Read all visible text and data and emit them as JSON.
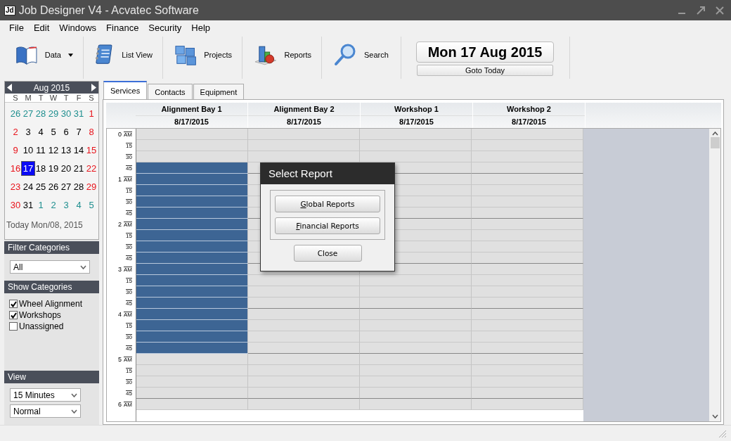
{
  "window": {
    "title": "Job Designer V4 - Acvatec Software",
    "icon_text": "Jd"
  },
  "menu": [
    "File",
    "Edit",
    "Windows",
    "Finance",
    "Security",
    "Help"
  ],
  "toolbar": [
    {
      "label": "Data",
      "dropdown": true
    },
    {
      "label": "List View",
      "dropdown": false
    },
    {
      "label": "Projects",
      "dropdown": false
    },
    {
      "label": "Reports",
      "dropdown": false
    },
    {
      "label": "Search",
      "dropdown": false
    }
  ],
  "date_display": {
    "date": "Mon 17 Aug 2015",
    "button": "Goto Today"
  },
  "calendar": {
    "month": "Aug 2015",
    "weekdays": [
      "S",
      "M",
      "T",
      "W",
      "T",
      "F",
      "S"
    ],
    "weeks": [
      [
        {
          "day": "26",
          "kind": "other",
          "selected": false
        },
        {
          "day": "27",
          "kind": "other",
          "selected": false
        },
        {
          "day": "28",
          "kind": "other",
          "selected": false
        },
        {
          "day": "29",
          "kind": "other",
          "selected": false
        },
        {
          "day": "30",
          "kind": "other",
          "selected": false
        },
        {
          "day": "31",
          "kind": "other",
          "selected": false
        },
        {
          "day": "1",
          "kind": "weekend",
          "selected": false
        }
      ],
      [
        {
          "day": "2",
          "kind": "weekend",
          "selected": false
        },
        {
          "day": "3",
          "kind": "weekday",
          "selected": false
        },
        {
          "day": "4",
          "kind": "weekday",
          "selected": false
        },
        {
          "day": "5",
          "kind": "weekday",
          "selected": false
        },
        {
          "day": "6",
          "kind": "weekday",
          "selected": false
        },
        {
          "day": "7",
          "kind": "weekday",
          "selected": false
        },
        {
          "day": "8",
          "kind": "weekend",
          "selected": false
        }
      ],
      [
        {
          "day": "9",
          "kind": "weekend",
          "selected": false
        },
        {
          "day": "10",
          "kind": "weekday",
          "selected": false
        },
        {
          "day": "11",
          "kind": "weekday",
          "selected": false
        },
        {
          "day": "12",
          "kind": "weekday",
          "selected": false
        },
        {
          "day": "13",
          "kind": "weekday",
          "selected": false
        },
        {
          "day": "14",
          "kind": "weekday",
          "selected": false
        },
        {
          "day": "15",
          "kind": "weekend",
          "selected": false
        }
      ],
      [
        {
          "day": "16",
          "kind": "weekend",
          "selected": false
        },
        {
          "day": "17",
          "kind": "weekday",
          "selected": true
        },
        {
          "day": "18",
          "kind": "weekday",
          "selected": false
        },
        {
          "day": "19",
          "kind": "weekday",
          "selected": false
        },
        {
          "day": "20",
          "kind": "weekday",
          "selected": false
        },
        {
          "day": "21",
          "kind": "weekday",
          "selected": false
        },
        {
          "day": "22",
          "kind": "weekend",
          "selected": false
        }
      ],
      [
        {
          "day": "23",
          "kind": "weekend",
          "selected": false
        },
        {
          "day": "24",
          "kind": "weekday",
          "selected": false
        },
        {
          "day": "25",
          "kind": "weekday",
          "selected": false
        },
        {
          "day": "26",
          "kind": "weekday",
          "selected": false
        },
        {
          "day": "27",
          "kind": "weekday",
          "selected": false
        },
        {
          "day": "28",
          "kind": "weekday",
          "selected": false
        },
        {
          "day": "29",
          "kind": "weekend",
          "selected": false
        }
      ],
      [
        {
          "day": "30",
          "kind": "weekend",
          "selected": false
        },
        {
          "day": "31",
          "kind": "weekday",
          "selected": false
        },
        {
          "day": "1",
          "kind": "other",
          "selected": false
        },
        {
          "day": "2",
          "kind": "other",
          "selected": false
        },
        {
          "day": "3",
          "kind": "other",
          "selected": false
        },
        {
          "day": "4",
          "kind": "other",
          "selected": false
        },
        {
          "day": "5",
          "kind": "other",
          "selected": false
        }
      ]
    ],
    "today": "Today Mon/08, 2015"
  },
  "filter_categories": {
    "title": "Filter Categories",
    "value": "All"
  },
  "show_categories": {
    "title": "Show Categories",
    "items": [
      {
        "label": "Wheel Alignment",
        "checked": true
      },
      {
        "label": "Workshops",
        "checked": true
      },
      {
        "label": "Unassigned",
        "checked": false
      }
    ]
  },
  "view": {
    "title": "View",
    "selects": [
      "15 Minutes",
      "Normal"
    ]
  },
  "tabs": [
    {
      "label": "Services",
      "selected": true
    },
    {
      "label": "Contacts",
      "selected": false
    },
    {
      "label": "Equipment",
      "selected": false
    }
  ],
  "schedule": {
    "columns": [
      {
        "name": "Alignment Bay 1",
        "date": "8/17/2015"
      },
      {
        "name": "Alignment Bay 2",
        "date": "8/17/2015"
      },
      {
        "name": "Workshop 1",
        "date": "8/17/2015"
      },
      {
        "name": "Workshop 2",
        "date": "8/17/2015"
      }
    ],
    "rows": [
      {
        "hour": "0",
        "period": "AM",
        "booked": [
          false,
          false,
          false,
          false
        ]
      },
      {
        "minute": "15",
        "booked": [
          false,
          false,
          false,
          false
        ]
      },
      {
        "minute": "30",
        "booked": [
          false,
          false,
          false,
          false
        ]
      },
      {
        "minute": "45",
        "booked": [
          true,
          false,
          false,
          false
        ]
      },
      {
        "hour": "1",
        "period": "AM",
        "booked": [
          true,
          false,
          false,
          false
        ]
      },
      {
        "minute": "15",
        "booked": [
          true,
          false,
          false,
          false
        ]
      },
      {
        "minute": "30",
        "booked": [
          true,
          false,
          false,
          false
        ]
      },
      {
        "minute": "45",
        "booked": [
          true,
          false,
          false,
          false
        ]
      },
      {
        "hour": "2",
        "period": "AM",
        "booked": [
          true,
          false,
          false,
          false
        ]
      },
      {
        "minute": "15",
        "booked": [
          true,
          false,
          false,
          false
        ]
      },
      {
        "minute": "30",
        "booked": [
          true,
          false,
          false,
          false
        ]
      },
      {
        "minute": "45",
        "booked": [
          true,
          false,
          false,
          false
        ]
      },
      {
        "hour": "3",
        "period": "AM",
        "booked": [
          true,
          false,
          false,
          false
        ]
      },
      {
        "minute": "15",
        "booked": [
          true,
          false,
          false,
          false
        ]
      },
      {
        "minute": "30",
        "booked": [
          true,
          false,
          false,
          false
        ]
      },
      {
        "minute": "45",
        "booked": [
          true,
          false,
          false,
          false
        ]
      },
      {
        "hour": "4",
        "period": "AM",
        "booked": [
          true,
          false,
          false,
          false
        ]
      },
      {
        "minute": "15",
        "booked": [
          true,
          false,
          false,
          false
        ]
      },
      {
        "minute": "30",
        "booked": [
          true,
          false,
          false,
          false
        ]
      },
      {
        "minute": "45",
        "booked": [
          true,
          false,
          false,
          false
        ]
      },
      {
        "hour": "5",
        "period": "AM",
        "booked": [
          false,
          false,
          false,
          false
        ]
      },
      {
        "minute": "15",
        "booked": [
          false,
          false,
          false,
          false
        ]
      },
      {
        "minute": "30",
        "booked": [
          false,
          false,
          false,
          false
        ]
      },
      {
        "minute": "45",
        "booked": [
          false,
          false,
          false,
          false
        ]
      },
      {
        "hour": "6",
        "period": "AM",
        "booked": [
          false,
          false,
          false,
          false
        ]
      }
    ]
  },
  "dialog": {
    "title": "Select Report",
    "buttons": [
      {
        "mnemonic": "G",
        "rest": "lobal Reports"
      },
      {
        "mnemonic": "F",
        "rest": "inancial Reports"
      }
    ],
    "close": "Close"
  }
}
